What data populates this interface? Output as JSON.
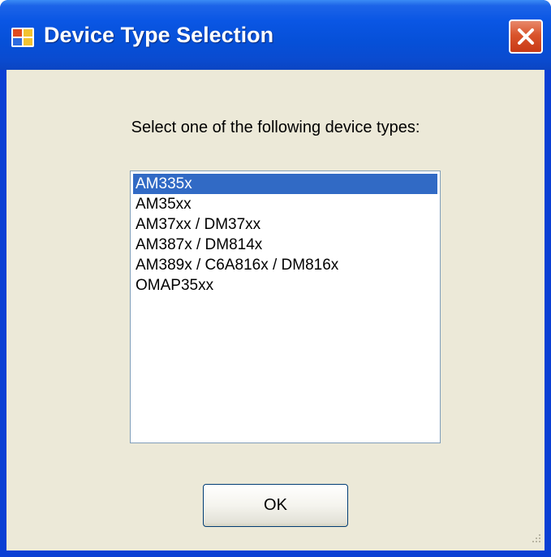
{
  "window": {
    "title": "Device Type Selection",
    "close_icon": "close-icon",
    "app_icon": "window-app-icon"
  },
  "dialog": {
    "prompt": "Select one of the following device types:",
    "device_types": [
      "AM335x",
      "AM35xx",
      "AM37xx / DM37xx",
      "AM387x / DM814x",
      "AM389x / C6A816x / DM816x",
      "OMAP35xx"
    ],
    "selected_device": "AM335x",
    "ok_label": "OK"
  },
  "colors": {
    "titlebar_blue": "#0a56e4",
    "dialog_background": "#ece9d8",
    "selection_highlight": "#316ac5",
    "close_button_red": "#d9542c"
  }
}
